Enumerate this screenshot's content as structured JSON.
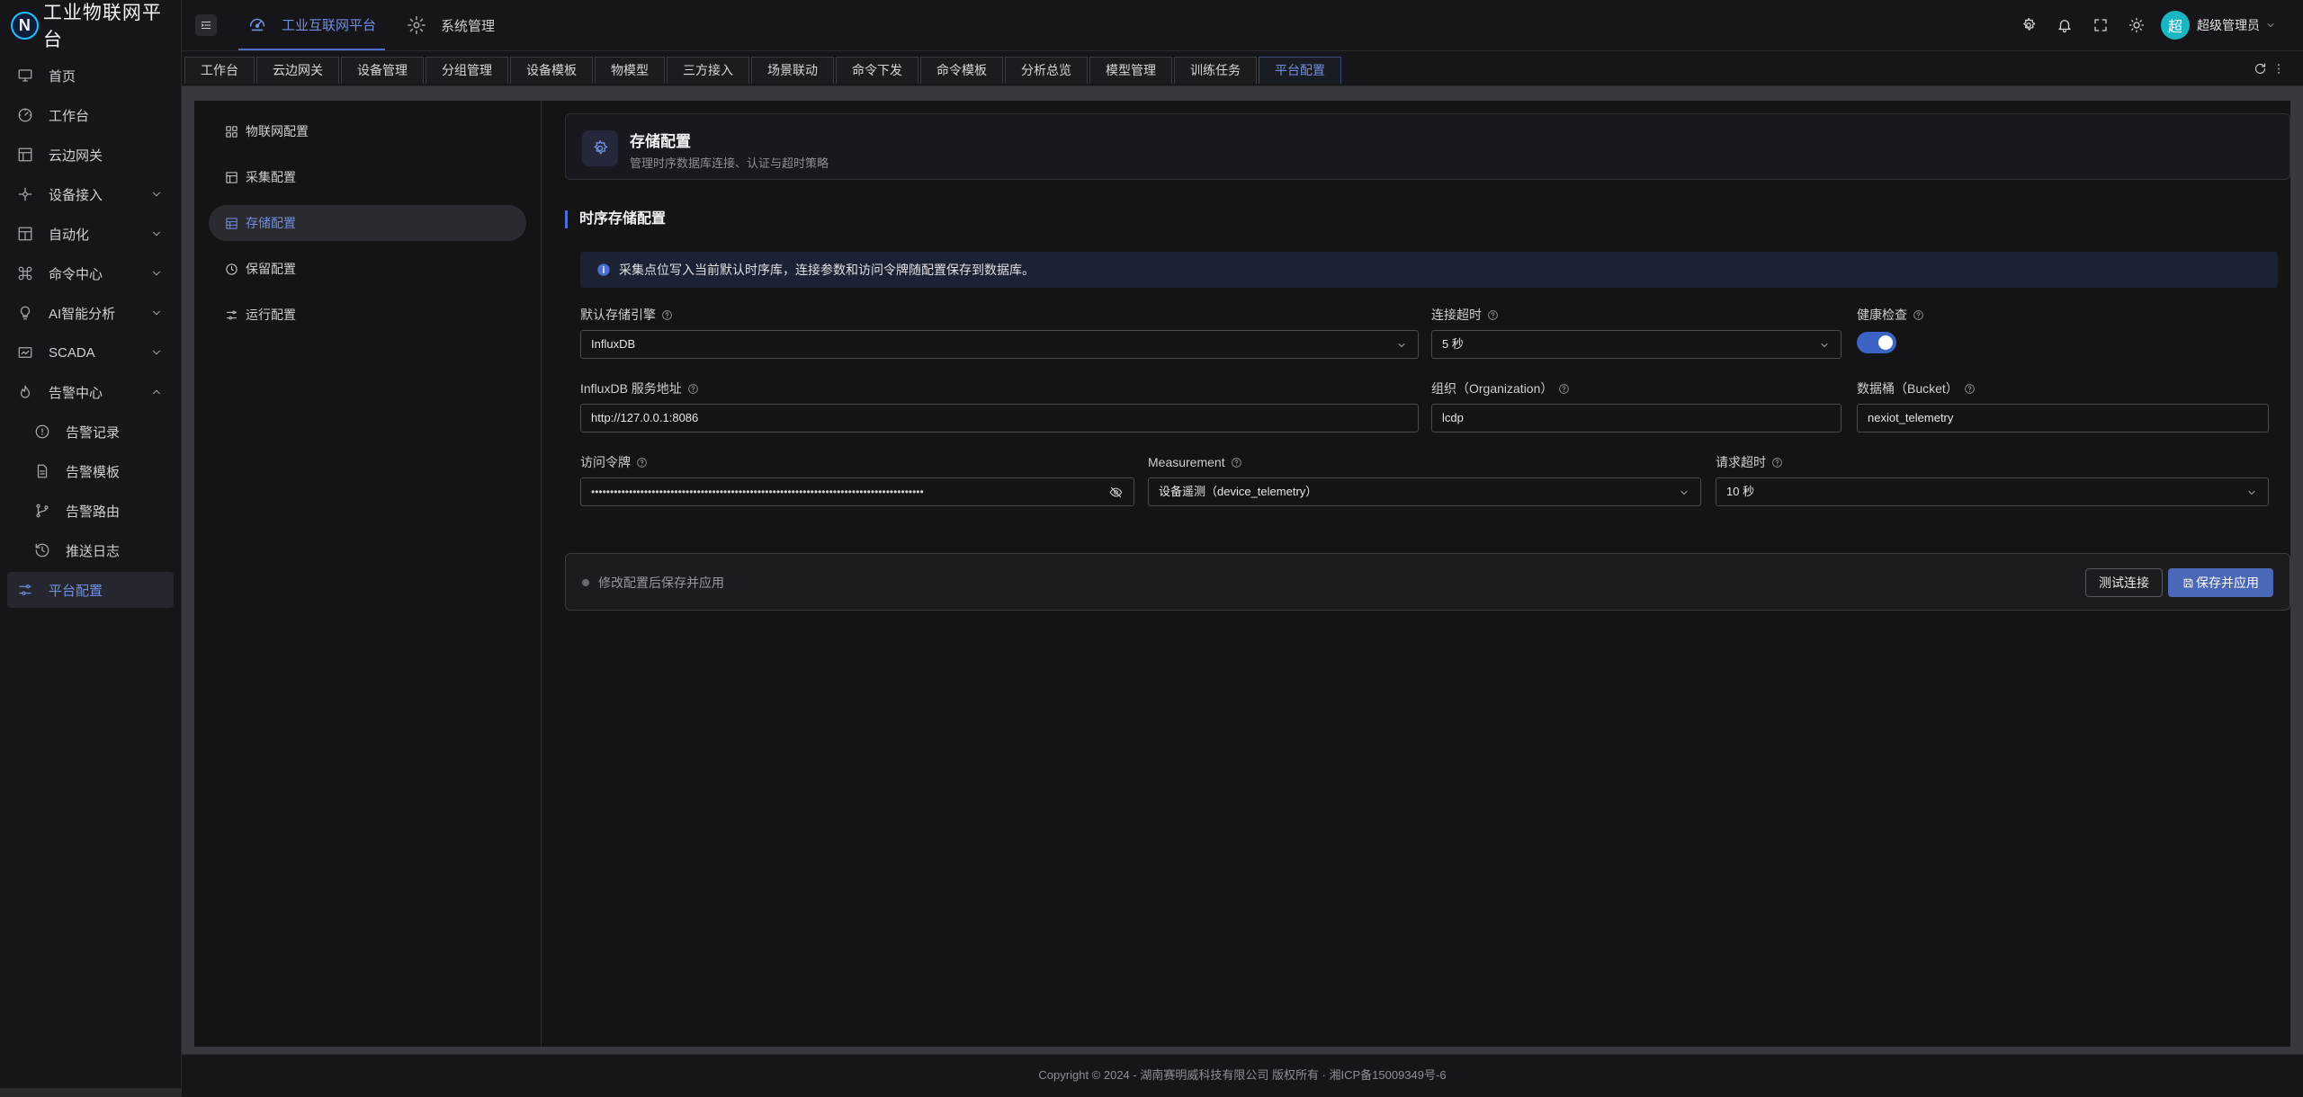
{
  "app": {
    "title": "工业物联网平台",
    "logo_letter": "N"
  },
  "sidebar": {
    "items": [
      {
        "label": "首页"
      },
      {
        "label": "工作台"
      },
      {
        "label": "云边网关"
      },
      {
        "label": "设备接入"
      },
      {
        "label": "自动化"
      },
      {
        "label": "命令中心"
      },
      {
        "label": "AI智能分析"
      },
      {
        "label": "SCADA"
      },
      {
        "label": "告警中心"
      },
      {
        "label": "告警记录"
      },
      {
        "label": "告警模板"
      },
      {
        "label": "告警路由"
      },
      {
        "label": "推送日志"
      },
      {
        "label": "平台配置"
      }
    ]
  },
  "header": {
    "tab_iot": "工业互联网平台",
    "tab_system": "系统管理",
    "avatar_letter": "超",
    "user_name": "超级管理员"
  },
  "page_tabs": [
    "工作台",
    "云边网关",
    "设备管理",
    "分组管理",
    "设备模板",
    "物模型",
    "三方接入",
    "场景联动",
    "命令下发",
    "命令模板",
    "分析总览",
    "模型管理",
    "训练任务",
    "平台配置"
  ],
  "subnav": {
    "items": [
      {
        "label": "物联网配置"
      },
      {
        "label": "采集配置"
      },
      {
        "label": "存储配置"
      },
      {
        "label": "保留配置"
      },
      {
        "label": "运行配置"
      }
    ]
  },
  "main": {
    "title": "存储配置",
    "description": "管理时序数据库连接、认证与超时策略",
    "section_title": "时序存储配置",
    "notice": "采集点位写入当前默认时序库，连接参数和访问令牌随配置保存到数据库。",
    "fields": {
      "engine": {
        "label": "默认存储引擎",
        "value": "InfluxDB"
      },
      "conn_timeout": {
        "label": "连接超时",
        "value": "5 秒"
      },
      "health": {
        "label": "健康检查",
        "value": true
      },
      "url": {
        "label": "InfluxDB 服务地址",
        "value": "http://127.0.0.1:8086"
      },
      "org": {
        "label": "组织（Organization）",
        "value": "lcdp"
      },
      "bucket": {
        "label": "数据桶（Bucket）",
        "value": "nexiot_telemetry"
      },
      "token": {
        "label": "访问令牌",
        "value": "••••••••••••••••••••••••••••••••••••••••••••••••••••••••••••••••••••••••••••••••••••••••"
      },
      "measurement": {
        "label": "Measurement",
        "value": "设备遥测（device_telemetry）"
      },
      "req_timeout": {
        "label": "请求超时",
        "value": "10 秒"
      }
    },
    "footer_status": "修改配置后保存并应用",
    "test_button": "测试连接",
    "save_button": "保存并应用"
  },
  "copyright": "Copyright © 2024 - 湖南赛明威科技有限公司 版权所有 · 湘ICP备15009349号-6",
  "colors": {
    "accent": "#4c6fd1",
    "accent_text": "#6f8fe0",
    "avatar": "#19b7c6",
    "primary_button": "#4a67b8"
  }
}
